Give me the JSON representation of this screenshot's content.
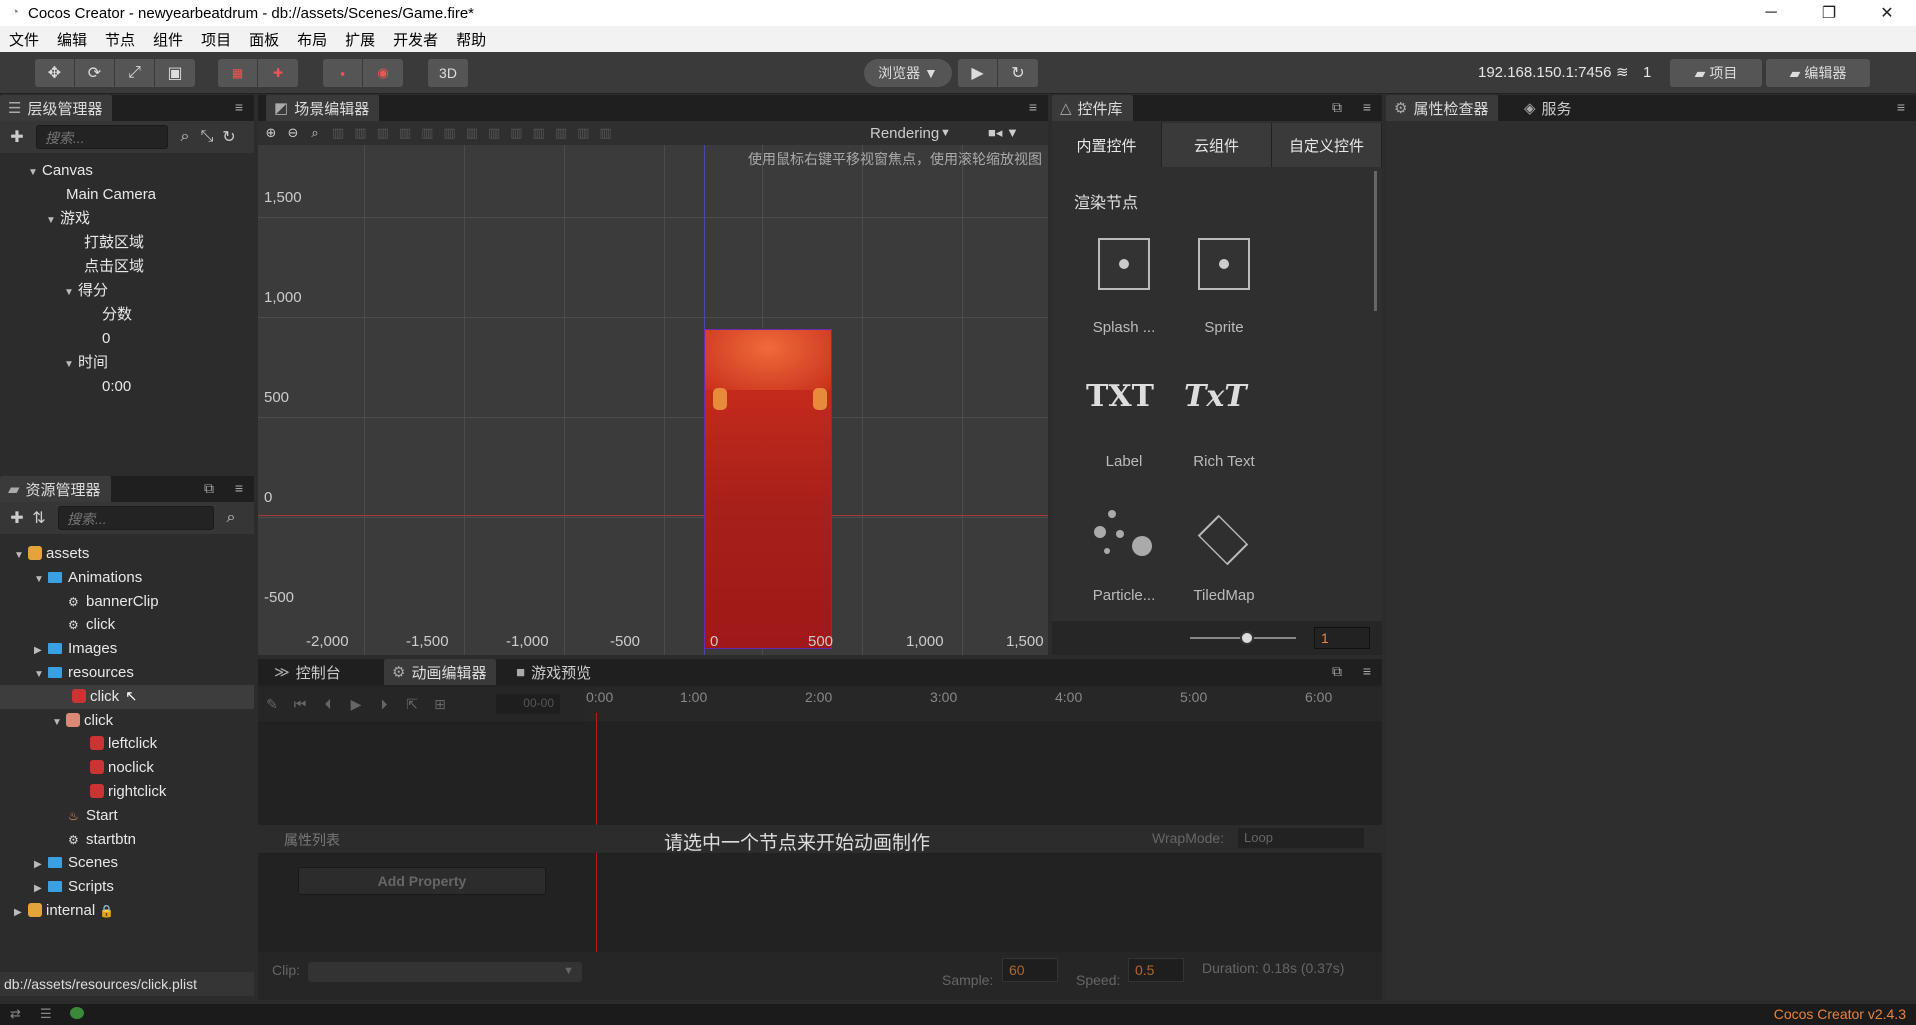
{
  "window": {
    "title": "Cocos Creator - newyearbeatdrum - db://assets/Scenes/Game.fire*",
    "minimize": "─",
    "maximize": "❐",
    "close": "✕"
  },
  "menu": [
    "文件",
    "编辑",
    "节点",
    "组件",
    "项目",
    "面板",
    "布局",
    "扩展",
    "开发者",
    "帮助"
  ],
  "toolbar": {
    "mode3d": "3D",
    "browser": "浏览器 ▼",
    "ip": "192.168.150.1:7456",
    "clients": "1",
    "project_btn": "项目",
    "editor_btn": "编辑器"
  },
  "hierarchy": {
    "tab": "层级管理器",
    "search_placeholder": "搜索...",
    "nodes": [
      "Canvas",
      "Main Camera",
      "游戏",
      "打鼓区域",
      "点击区域",
      "得分",
      "分数",
      "0",
      "时间",
      "0:00"
    ]
  },
  "assets": {
    "tab": "资源管理器",
    "search_placeholder": "搜索...",
    "items": [
      "assets",
      "Animations",
      "bannerClip",
      "click",
      "Images",
      "resources",
      "click",
      "click",
      "leftclick",
      "noclick",
      "rightclick",
      "Start",
      "startbtn",
      "Scenes",
      "Scripts",
      "internal"
    ],
    "status": "db://assets/resources/click.plist"
  },
  "scene": {
    "tab": "场景编辑器",
    "render_mode": "Rendering",
    "hint": "使用鼠标右键平移视窗焦点，使用滚轮缩放视图",
    "yticks": [
      "1,500",
      "1,000",
      "500",
      "0",
      "-500"
    ],
    "xticks": [
      "-2,000",
      "-1,500",
      "-1,000",
      "-500",
      "0",
      "500",
      "1,000",
      "1,500"
    ]
  },
  "library": {
    "tab": "控件库",
    "tabs": [
      "内置控件",
      "云组件",
      "自定义控件"
    ],
    "section": "渲染节点",
    "items": [
      "Splash ...",
      "Sprite",
      "Label",
      "Rich Text",
      "Particle...",
      "TiledMap"
    ],
    "zoom_value": "1"
  },
  "inspector": {
    "tab": "属性检查器",
    "service_tab": "服务"
  },
  "bottom": {
    "tabs": [
      "控制台",
      "动画编辑器",
      "游戏预览"
    ],
    "frame": "00-00",
    "times": [
      "0:00",
      "1:00",
      "2:00",
      "3:00",
      "4:00",
      "5:00",
      "6:00"
    ],
    "prop_list": "属性列表",
    "prompt": "请选中一个节点来开始动画制作",
    "wrap_label": "WrapMode:",
    "wrap_value": "Loop",
    "add_property": "Add Property",
    "clip_label": "Clip:",
    "sample_label": "Sample:",
    "sample_value": "60",
    "speed_label": "Speed:",
    "speed_value": "0.5",
    "duration": "Duration: 0.18s (0.37s)"
  },
  "footer": {
    "version": "Cocos Creator v2.4.3"
  }
}
